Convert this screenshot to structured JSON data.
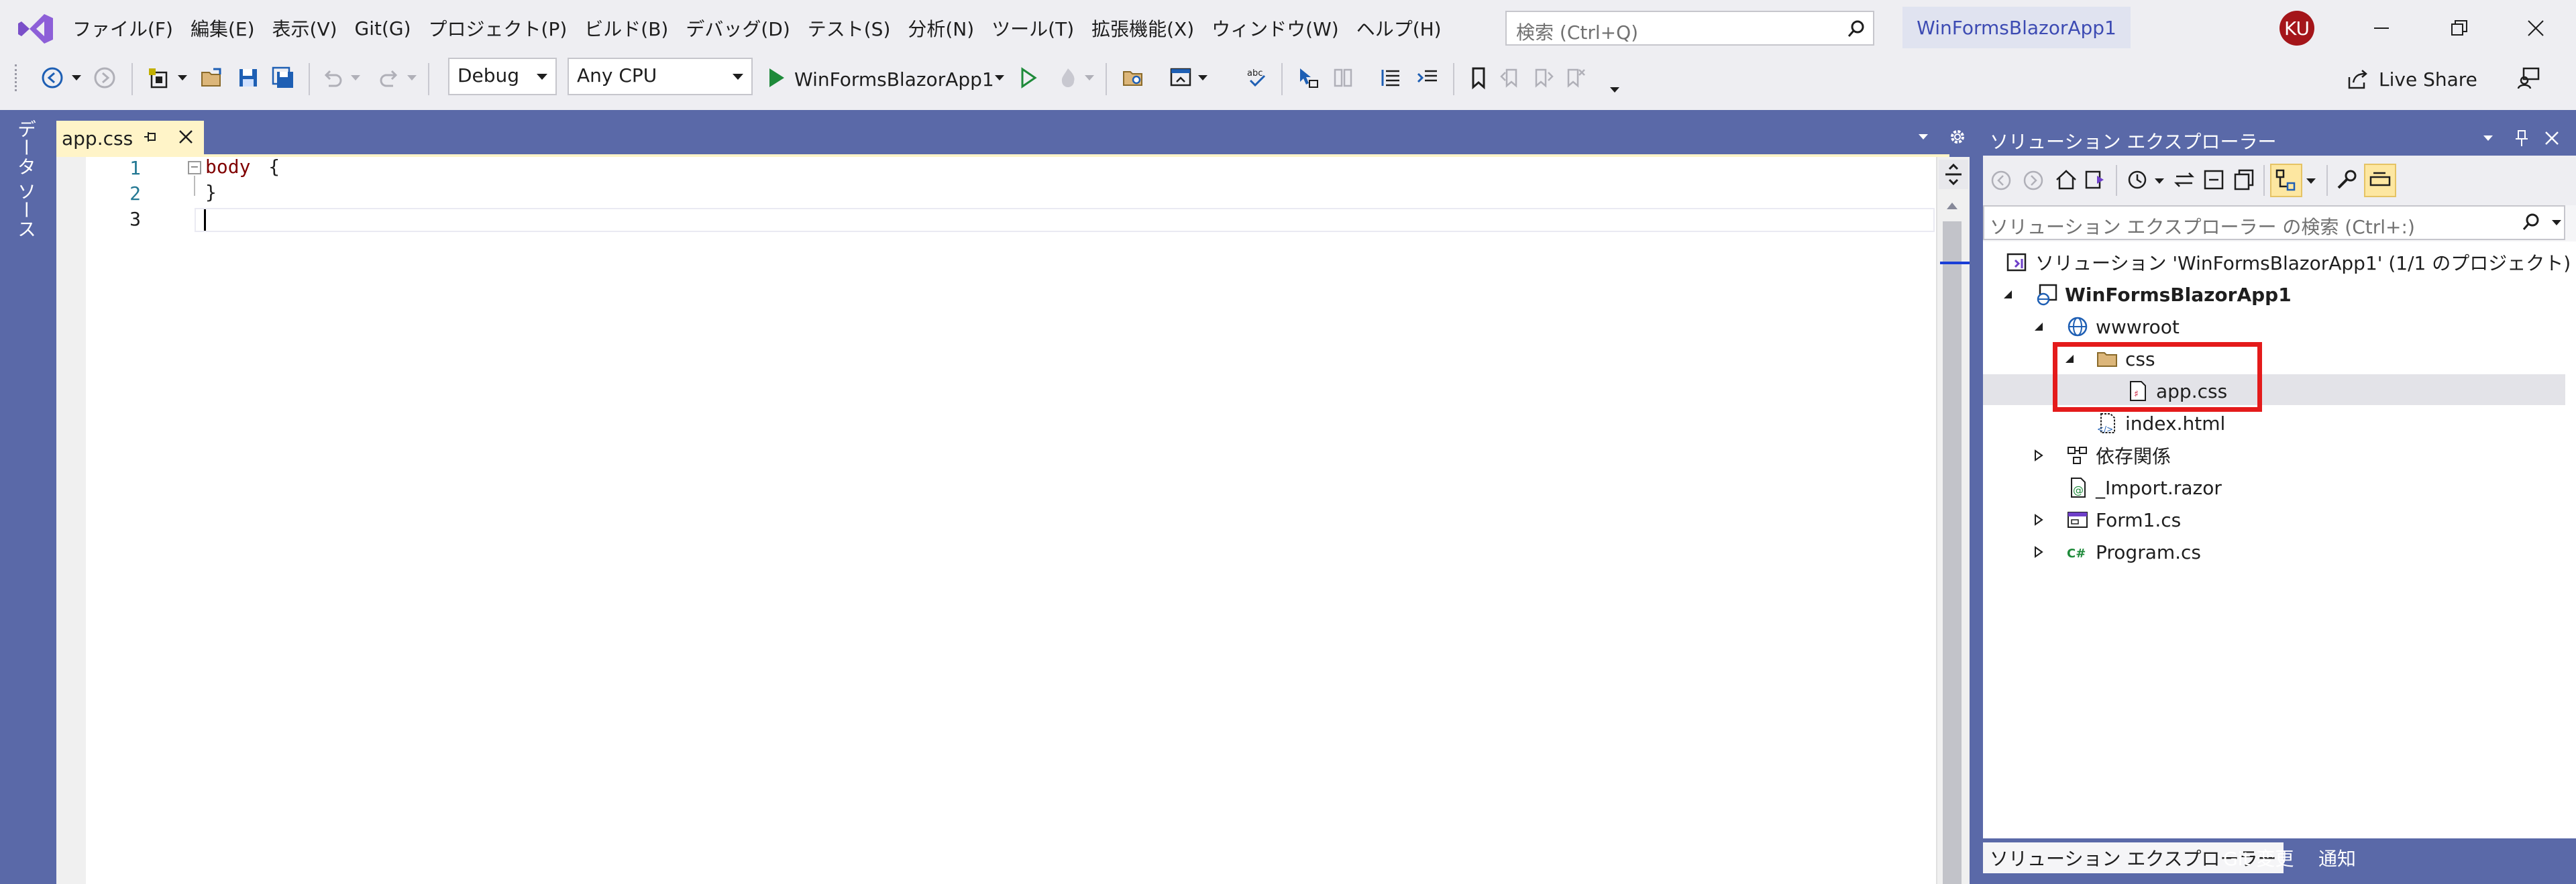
{
  "menu": {
    "items": [
      "ファイル(F)",
      "編集(E)",
      "表示(V)",
      "Git(G)",
      "プロジェクト(P)",
      "ビルド(B)",
      "デバッグ(D)",
      "テスト(S)",
      "分析(N)",
      "ツール(T)",
      "拡張機能(X)",
      "ウィンドウ(W)",
      "ヘルプ(H)"
    ]
  },
  "search": {
    "placeholder": "検索 (Ctrl+Q)"
  },
  "solution_name": "WinFormsBlazorApp1",
  "account": {
    "initials": "KU"
  },
  "live_share": "Live Share",
  "toolbar": {
    "configuration": "Debug",
    "platform": "Any CPU",
    "run_target": "WinFormsBlazorApp1"
  },
  "side_panel": {
    "label": "データ ソース"
  },
  "editor": {
    "tab_title": "app.css",
    "lines": [
      {
        "number": "1",
        "code_selector": "body",
        "code_brace": "{"
      },
      {
        "number": "2",
        "code": "}"
      },
      {
        "number": "3",
        "code": ""
      }
    ]
  },
  "solution_explorer": {
    "title": "ソリューション エクスプローラー",
    "search_placeholder": "ソリューション エクスプローラー の検索 (Ctrl+:)",
    "tree": {
      "solution": "ソリューション 'WinFormsBlazorApp1' (1/1 のプロジェクト)",
      "project": "WinFormsBlazorApp1",
      "wwwroot": "wwwroot",
      "css_folder": "css",
      "app_css": "app.css",
      "index_html": "index.html",
      "dependencies": "依存関係",
      "import_razor": "_Import.razor",
      "form1": "Form1.cs",
      "program": "Program.cs"
    },
    "tabs": [
      "ソリューション エクスプローラー",
      "Git 変更",
      "通知"
    ]
  },
  "colors": {
    "accent_purple": "#5a69a8",
    "highlight_red": "#e41b1b",
    "active_tab": "#fff4c8",
    "run_green": "#1e8a3a"
  }
}
